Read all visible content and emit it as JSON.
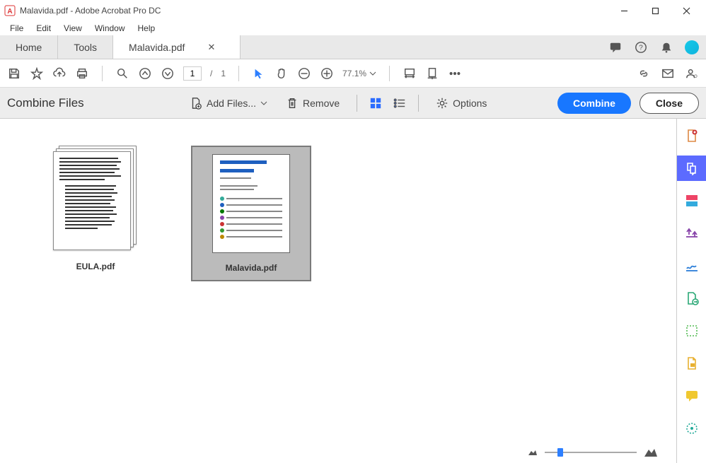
{
  "window": {
    "title": "Malavida.pdf - Adobe Acrobat Pro DC"
  },
  "menu": {
    "file": "File",
    "edit": "Edit",
    "view": "View",
    "window": "Window",
    "help": "Help"
  },
  "tabs": {
    "home": "Home",
    "tools": "Tools",
    "doc": "Malavida.pdf"
  },
  "toolbar": {
    "page_current": "1",
    "page_sep": "/",
    "page_total": "1",
    "zoom": "77.1%"
  },
  "panel": {
    "title": "Combine Files",
    "add": "Add Files...",
    "remove": "Remove",
    "options": "Options",
    "combine": "Combine",
    "close": "Close"
  },
  "files": [
    {
      "name": "EULA.pdf",
      "selected": false
    },
    {
      "name": "Malavida.pdf",
      "selected": true
    }
  ]
}
